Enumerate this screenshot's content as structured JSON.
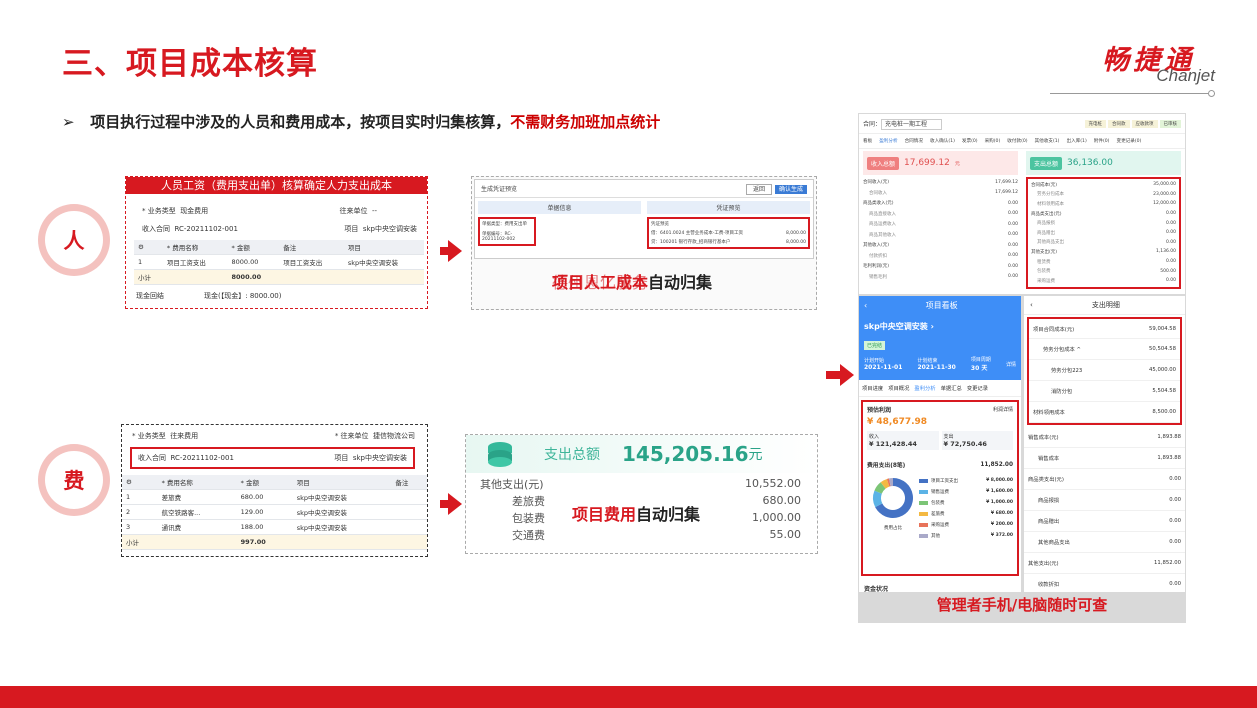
{
  "slide": {
    "title": "三、项目成本核算",
    "bullet_prefix": "项目执行过程中涉及的人员和费用成本，按项目实时归集核算，",
    "bullet_red": "不需财务加班加点统计",
    "bullet_mark": "➢"
  },
  "logo": {
    "cn": "畅捷通",
    "en": "Chanjet"
  },
  "colors": {
    "accent": "#d71920",
    "light": "#f4c2bf"
  },
  "people": {
    "circle": "人",
    "bar": "人员工资（费用支出单）核算确定人力支出成本",
    "biz_type_label": "* 业务类型",
    "biz_type_value": "现金费用",
    "partner_label": "往来单位",
    "partner_value": "--",
    "contract_label": "收入合同",
    "contract_value": "RC-20211102-001",
    "project_label": "项目",
    "project_value": "skp中央空调安装",
    "headers": [
      "",
      "* 费用名称",
      "* 金额",
      "备注",
      "项目"
    ],
    "rows": [
      [
        "1",
        "项目工资支出",
        "8000.00",
        "项目工资支出",
        "skp中央空调安装"
      ]
    ],
    "subtotal_label": "小计",
    "subtotal_value": "8000.00",
    "footer_left": "现金回结",
    "footer_right": "现金(【现金】: 8000.00)",
    "screen_title": "生成凭证预览",
    "screen_btn1": "返回",
    "screen_btn2": "确认生成",
    "left_head": "单据信息",
    "right_head": "凭证预览",
    "left_line1": "单据类型：费用支出单",
    "left_line2": "单据编号：RC-20211102-002",
    "right_line0": "凭证预览",
    "right_line1": "借：6401.0024 主营业务成本-工费-项目工资",
    "right_line2": "贷：100201 银行存款_招商银行基本户",
    "right_amt1": "8,000.00",
    "right_amt2": "8,000.00",
    "caption_red": "项目人工成本",
    "caption_black": "自动归集",
    "watermark": "德州恩亿服务"
  },
  "fees": {
    "circle": "费",
    "biz_type_label": "* 业务类型",
    "biz_type_value": "往来费用",
    "partner_label": "* 往来单位",
    "partner_value": "捷信物流公司",
    "contract_label": "收入合同",
    "contract_value": "RC-20211102-001",
    "project_label": "项目",
    "project_value": "skp中央空调安装",
    "headers": [
      "",
      "* 费用名称",
      "* 金额",
      "项目",
      "备注"
    ],
    "rows": [
      [
        "1",
        "差旅费",
        "680.00",
        "skp中央空调安装",
        ""
      ],
      [
        "2",
        "航空铁路客...",
        "129.00",
        "skp中央空调安装",
        ""
      ],
      [
        "3",
        "通讯费",
        "188.00",
        "skp中央空调安装",
        ""
      ]
    ],
    "subtotal_label": "小计",
    "subtotal_value": "997.00",
    "total_label": "支出总额",
    "total_value": "145,205.16",
    "total_unit": "元",
    "lines": [
      {
        "label": "其他支出(元)",
        "value": "10,552.00"
      },
      {
        "label": "差旅费",
        "value": "680.00"
      },
      {
        "label": "包装费",
        "value": "1,000.00"
      },
      {
        "label": "交通费",
        "value": "55.00"
      }
    ],
    "caption_red": "项目费用",
    "caption_black": "自动归集"
  },
  "desktop": {
    "project_label": "合同：",
    "project": "充电桩一期工程",
    "tag_buttons": [
      "充电桩",
      "合同款",
      "应收款项",
      "已审核"
    ],
    "tabs": [
      "看板",
      "盈利分析",
      "合同情况",
      "收入确认(1)",
      "发票(0)",
      "采购(0)",
      "收付款(0)",
      "其他收支(1)",
      "出入库(1)",
      "附件(0)",
      "变更记录(0)"
    ],
    "income_label": "收入总额",
    "income_value": "17,699.12",
    "income_unit": "元",
    "expense_label": "支出总额",
    "expense_value": "36,136.00",
    "left_rows": [
      [
        "合同收入(元)",
        "17,699.12"
      ],
      [
        "合同收入",
        "17,699.12"
      ],
      [
        "商品类收入(元)",
        "0.00"
      ],
      [
        "商品直接收入",
        "0.00"
      ],
      [
        "商品运费收入",
        "0.00"
      ],
      [
        "商品其他收入",
        "0.00"
      ],
      [
        "其他收入(元)",
        "0.00"
      ],
      [
        "付款折扣",
        "0.00"
      ],
      [
        "毛利利润(元)",
        "0.00"
      ],
      [
        "销售毛利",
        "0.00"
      ]
    ],
    "right_rows": [
      [
        "合同成本(元)",
        "35,000.00"
      ],
      [
        "劳务分包成本",
        "23,000.00"
      ],
      [
        "材料领用成本",
        "12,000.00"
      ],
      [
        "商品类支出(元)",
        "0.00"
      ],
      [
        "商品报损",
        "0.00"
      ],
      [
        "商品赠出",
        "0.00"
      ],
      [
        "其他商品支出",
        "0.00"
      ],
      [
        "其他支出(元)",
        "1,136.00"
      ],
      [
        "租赁费",
        "0.00"
      ],
      [
        "包装费",
        "500.00"
      ],
      [
        "采购运费",
        "0.00"
      ]
    ]
  },
  "mobile1": {
    "header": "项目看板",
    "project": "skp中央空调安装",
    "status": "已完结",
    "plan_start_label": "计划开始",
    "plan_start": "2021-11-01",
    "plan_end_label": "计划结束",
    "plan_end": "2021-11-30",
    "cycle_label": "项目周期",
    "cycle": "30 天",
    "detail": "详情",
    "tabs": [
      "项目进度",
      "项目概况",
      "盈利分析",
      "单据汇总",
      "变更记录"
    ],
    "profit_label": "预估利润",
    "profit_detail": "利润详情",
    "profit_value": "¥ 48,677.98",
    "income_label": "收入",
    "income_value": "¥ 121,428.44",
    "expense_label": "支出",
    "expense_value": "¥ 72,750.46",
    "fee_title": "费用支出(8笔)",
    "fee_total": "11,852.00",
    "donut_label": "费用占比",
    "legend": [
      {
        "name": "项目工资支出",
        "value": "¥ 8,000.00",
        "color": "#4472c4"
      },
      {
        "name": "销售运费",
        "value": "¥ 1,600.00",
        "color": "#5bb3e6"
      },
      {
        "name": "包装费",
        "value": "¥ 1,000.00",
        "color": "#7cc576"
      },
      {
        "name": "差旅费",
        "value": "¥ 680.00",
        "color": "#f4b942"
      },
      {
        "name": "采购运费",
        "value": "¥ 200.00",
        "color": "#e8735a"
      },
      {
        "name": "其他",
        "value": "¥ 372.00",
        "color": "#a9a9c9"
      }
    ],
    "shares": [
      0.675,
      0.135,
      0.084,
      0.057,
      0.017,
      0.032
    ],
    "bottom": "资金状况"
  },
  "mobile2": {
    "header": "支出明细",
    "rows": [
      [
        "项目合同成本(元)",
        "59,004.58"
      ],
      [
        "劳务分包成本 ^",
        "50,504.58"
      ],
      [
        "劳务分包223",
        "45,000.00"
      ],
      [
        "消防分包",
        "5,504.58"
      ],
      [
        "材料领用成本",
        "8,500.00"
      ],
      [
        "销售成本(元)",
        "1,893.88"
      ],
      [
        "销售成本",
        "1,893.88"
      ],
      [
        "商品类支出(元)",
        "0.00"
      ],
      [
        "商品报损",
        "0.00"
      ],
      [
        "商品赠出",
        "0.00"
      ],
      [
        "其他商品支出",
        "0.00"
      ],
      [
        "其他支出(元)",
        "11,852.00"
      ],
      [
        "收款折扣",
        "0.00"
      ]
    ]
  },
  "manager_caption": "管理者手机/电脑随时可查"
}
